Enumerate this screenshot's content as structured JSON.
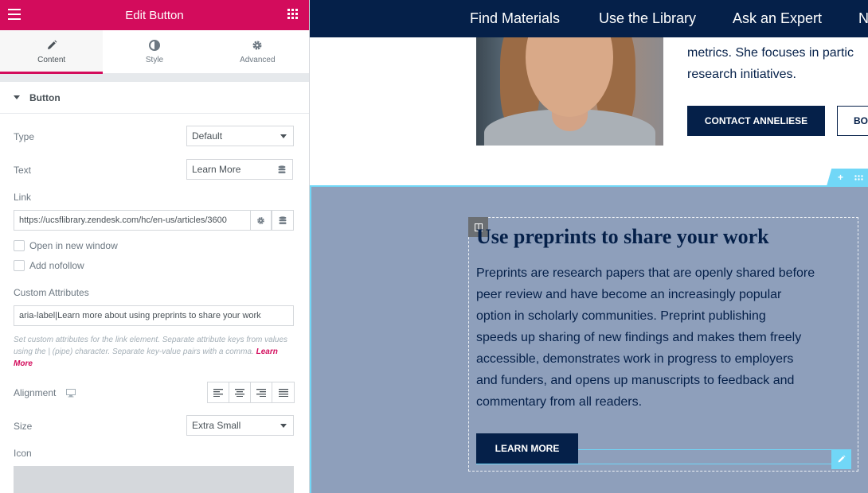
{
  "panel": {
    "title": "Edit Button",
    "tabs": [
      {
        "label": "Content",
        "icon": "pencil-icon"
      },
      {
        "label": "Style",
        "icon": "half-circle-icon"
      },
      {
        "label": "Advanced",
        "icon": "gear-icon"
      }
    ],
    "section": "Button",
    "controls": {
      "type": {
        "label": "Type",
        "value": "Default"
      },
      "text": {
        "label": "Text",
        "value": "Learn More"
      },
      "link": {
        "label": "Link",
        "value": "https://ucsflibrary.zendesk.com/hc/en-us/articles/3600"
      },
      "open_new_window": {
        "label": "Open in new window",
        "checked": false
      },
      "nofollow": {
        "label": "Add nofollow",
        "checked": false
      },
      "custom_attributes": {
        "label": "Custom Attributes",
        "value": "aria-label|Learn more about using preprints to share your work",
        "description": "Set custom attributes for the link element. Separate attribute keys from values using the | (pipe) character. Separate key-value pairs with a comma.",
        "learn_more": "Learn More"
      },
      "alignment": {
        "label": "Alignment"
      },
      "size": {
        "label": "Size",
        "value": "Extra Small"
      },
      "icon": {
        "label": "Icon"
      }
    },
    "accent_color": "#d30c5c"
  },
  "preview": {
    "nav": [
      "Find Materials",
      "Use the Library",
      "Ask an Expert",
      "N"
    ],
    "bio_lines": [
      "metrics. She focuses in partic",
      "research initiatives."
    ],
    "contact_button": "CONTACT ANNELIESE",
    "book_button": "BO",
    "section": {
      "heading": "Use preprints to share your work",
      "paragraph_lines": [
        "Preprints are research papers that are openly shared before",
        "peer review and have become an increasingly popular",
        "option in scholarly communities. Preprint publishing",
        "speeds up sharing of new findings and makes them freely",
        "accessible, demonstrates work in progress to employers",
        "and funders, and opens up manuscripts to feedback and",
        "commentary from all readers."
      ],
      "button": "LEARN MORE",
      "background_color": "#8e9fbb"
    },
    "navy_color": "#052049",
    "selection_color": "#71d7f7"
  }
}
